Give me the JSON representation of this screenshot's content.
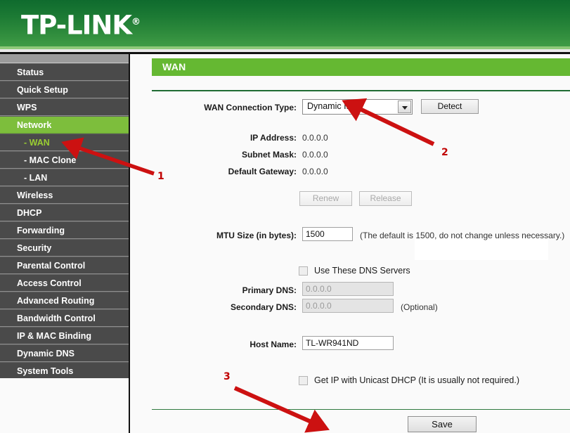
{
  "brand": {
    "name": "TP-LINK",
    "registered": "®"
  },
  "sidebar": {
    "items": [
      {
        "label": "Status",
        "type": "top",
        "state": "normal"
      },
      {
        "label": "Quick Setup",
        "type": "top",
        "state": "normal"
      },
      {
        "label": "WPS",
        "type": "top",
        "state": "normal"
      },
      {
        "label": "Network",
        "type": "top",
        "state": "active"
      },
      {
        "label": "- WAN",
        "type": "sub",
        "state": "current"
      },
      {
        "label": "- MAC Clone",
        "type": "sub",
        "state": "normal"
      },
      {
        "label": "- LAN",
        "type": "sub",
        "state": "normal"
      },
      {
        "label": "Wireless",
        "type": "top",
        "state": "normal"
      },
      {
        "label": "DHCP",
        "type": "top",
        "state": "normal"
      },
      {
        "label": "Forwarding",
        "type": "top",
        "state": "normal"
      },
      {
        "label": "Security",
        "type": "top",
        "state": "normal"
      },
      {
        "label": "Parental Control",
        "type": "top",
        "state": "normal"
      },
      {
        "label": "Access Control",
        "type": "top",
        "state": "normal"
      },
      {
        "label": "Advanced Routing",
        "type": "top",
        "state": "normal"
      },
      {
        "label": "Bandwidth Control",
        "type": "top",
        "state": "normal"
      },
      {
        "label": "IP & MAC Binding",
        "type": "top",
        "state": "normal"
      },
      {
        "label": "Dynamic DNS",
        "type": "top",
        "state": "normal"
      },
      {
        "label": "System Tools",
        "type": "top",
        "state": "normal"
      }
    ]
  },
  "page": {
    "title": "WAN"
  },
  "form": {
    "connection_type_label": "WAN Connection Type:",
    "connection_type_value": "Dynamic IP",
    "detect_button": "Detect",
    "ip_address_label": "IP Address:",
    "ip_address_value": "0.0.0.0",
    "subnet_mask_label": "Subnet Mask:",
    "subnet_mask_value": "0.0.0.0",
    "default_gateway_label": "Default Gateway:",
    "default_gateway_value": "0.0.0.0",
    "renew_button": "Renew",
    "release_button": "Release",
    "mtu_label": "MTU Size (in bytes):",
    "mtu_value": "1500",
    "mtu_hint": "(The default is 1500, do not change unless necessary.)",
    "use_dns_label": "Use These DNS Servers",
    "primary_dns_label": "Primary DNS:",
    "primary_dns_value": "0.0.0.0",
    "secondary_dns_label": "Secondary DNS:",
    "secondary_dns_value": "0.0.0.0",
    "secondary_dns_hint": "(Optional)",
    "host_name_label": "Host Name:",
    "host_name_value": "TL-WR941ND",
    "unicast_dhcp_label": "Get IP with Unicast DHCP (It is usually not required.)",
    "save_button": "Save"
  },
  "annotations": [
    {
      "number": "1"
    },
    {
      "number": "2"
    },
    {
      "number": "3"
    }
  ],
  "colors": {
    "header_green_dark": "#0f6b2e",
    "header_green_light": "#3f9b45",
    "accent_green": "#65b832",
    "menu_active_green": "#7dbe3c",
    "menu_current_text": "#9acd32",
    "sidebar_gray": "#4a4a4a",
    "annotation_red": "#c00000"
  }
}
